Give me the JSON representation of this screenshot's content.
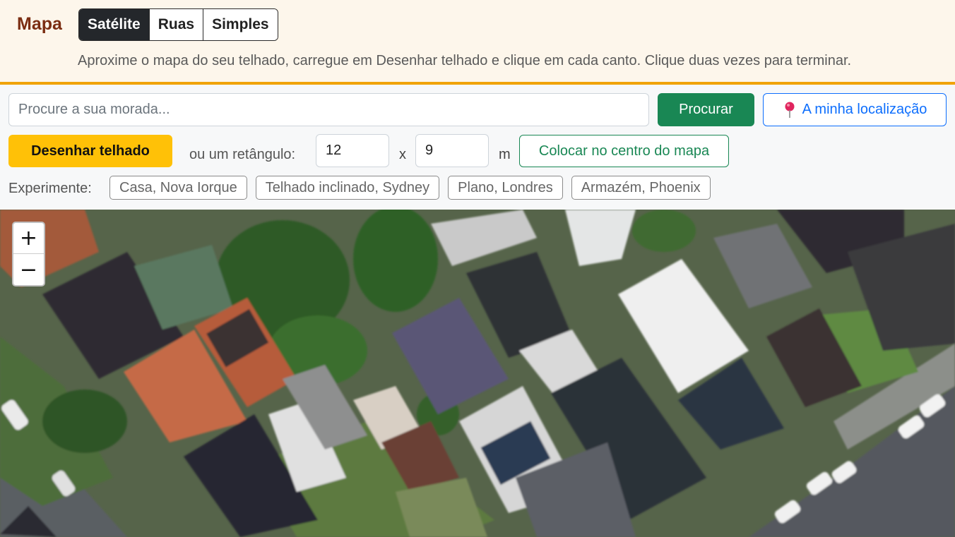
{
  "header": {
    "title": "Mapa",
    "layers": [
      {
        "label": "Satélite",
        "active": true
      },
      {
        "label": "Ruas",
        "active": false
      },
      {
        "label": "Simples",
        "active": false
      }
    ],
    "hint": "Aproxime o mapa do seu telhado, carregue em Desenhar telhado e clique em cada canto. Clique duas vezes para terminar."
  },
  "search": {
    "placeholder": "Procure a sua morada...",
    "value": "",
    "search_label": "Procurar",
    "location_label": "A minha localização",
    "location_icon": "map-pin-icon"
  },
  "draw": {
    "draw_label": "Desenhar telhado",
    "rect_label": "ou um retângulo:",
    "width_value": "12",
    "times_symbol": "x",
    "height_value": "9",
    "unit": "m",
    "center_label": "Colocar no centro do mapa"
  },
  "examples": {
    "label": "Experimente:",
    "items": [
      "Casa, Nova Iorque",
      "Telhado inclinado, Sydney",
      "Plano, Londres",
      "Armazém, Phoenix"
    ]
  },
  "map": {
    "zoom_in": "+",
    "zoom_out": "−"
  },
  "colors": {
    "title": "#7b2d12",
    "accent_border": "#f0a30a",
    "primary_green": "#198754",
    "primary_blue": "#0d6efd",
    "draw_yellow": "#ffc107"
  }
}
